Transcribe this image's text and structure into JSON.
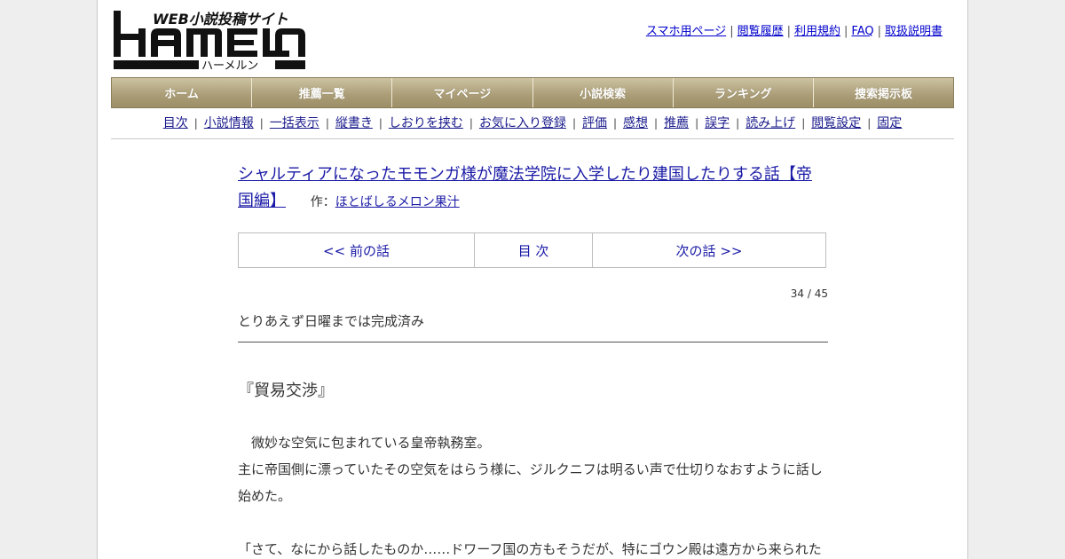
{
  "logo": {
    "tagline": "WEB小説投稿サイト",
    "wordmark": "HAMELN",
    "reading": "ハーメルン"
  },
  "header_links": [
    {
      "label": "スマホ用ページ"
    },
    {
      "label": "閲覧履歴"
    },
    {
      "label": "利用規約"
    },
    {
      "label": "FAQ"
    },
    {
      "label": "取扱説明書"
    }
  ],
  "main_nav": [
    {
      "label": "ホーム"
    },
    {
      "label": "推薦一覧"
    },
    {
      "label": "マイページ"
    },
    {
      "label": "小説検索"
    },
    {
      "label": "ランキング"
    },
    {
      "label": "捜索掲示板"
    }
  ],
  "sub_nav": [
    {
      "label": "目次"
    },
    {
      "label": "小説情報"
    },
    {
      "label": "一括表示"
    },
    {
      "label": "縦書き"
    },
    {
      "label": "しおりを挟む"
    },
    {
      "label": "お気に入り登録"
    },
    {
      "label": "評価"
    },
    {
      "label": "感想"
    },
    {
      "label": "推薦"
    },
    {
      "label": "誤字"
    },
    {
      "label": "読み上げ"
    },
    {
      "label": "閲覧設定"
    },
    {
      "label": "固定"
    }
  ],
  "novel": {
    "title": "シャルティアになったモモンガ様が魔法学院に入学したり建国したりする話【帝国編】",
    "author_label": "作：",
    "author": "ほとばしるメロン果汁"
  },
  "pager": {
    "prev": "<< 前の話",
    "toc": "目 次",
    "next": "次の話 >>"
  },
  "episode": {
    "counter": "34 / 45",
    "preface": "とりあえず日曜までは完成済み",
    "chapter_title": "『貿易交渉』",
    "paragraphs": [
      "　微妙な空気に包まれている皇帝執務室。",
      "主に帝国側に漂っていたその空気をはらう様に、ジルクニフは明るい声で仕切りなおすように話し始めた。",
      "",
      "「さて、なにから話したものか……ドワーフ国の方もそうだが、特にゴウン殿は遠方から来られた"
    ]
  }
}
